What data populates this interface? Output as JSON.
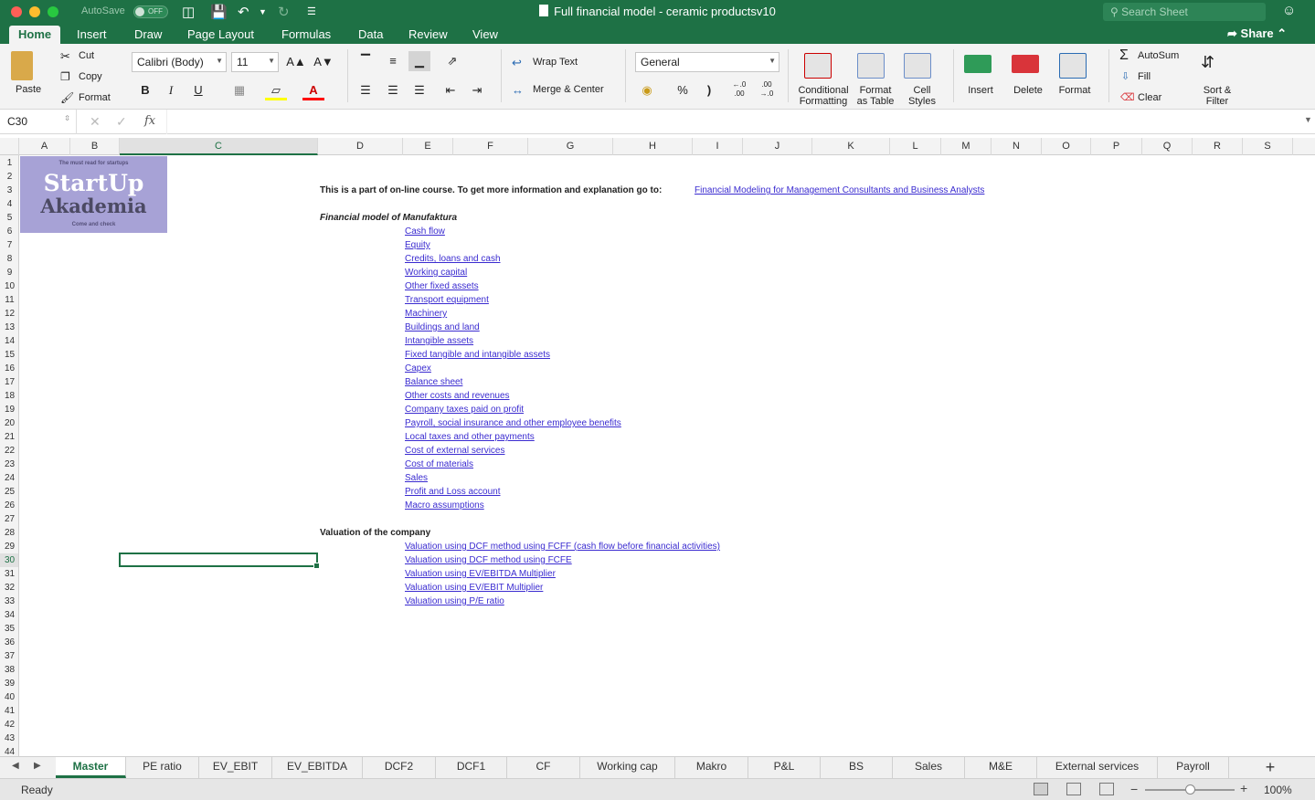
{
  "window": {
    "autosave_label": "AutoSave",
    "autosave_state": "OFF",
    "title": "Full financial model - ceramic productsv10",
    "search_placeholder": "Search Sheet"
  },
  "ribbon_tabs": [
    "Home",
    "Insert",
    "Draw",
    "Page Layout",
    "Formulas",
    "Data",
    "Review",
    "View"
  ],
  "active_ribbon_tab": "Home",
  "share_label": "Share",
  "ribbon": {
    "paste": "Paste",
    "cut": "Cut",
    "copy": "Copy",
    "format_painter": "Format",
    "font_name": "Calibri (Body)",
    "font_size": "11",
    "bold": "B",
    "italic": "I",
    "underline": "U",
    "wrap_text": "Wrap Text",
    "merge_center": "Merge & Center",
    "number_format": "General",
    "percent": "%",
    "comma": ")",
    "conditional_formatting": "Conditional\nFormatting",
    "format_as_table": "Format\nas Table",
    "cell_styles": "Cell\nStyles",
    "insert": "Insert",
    "delete": "Delete",
    "format": "Format",
    "autosum": "AutoSum",
    "fill": "Fill",
    "clear": "Clear",
    "sort_filter": "Sort &\nFilter"
  },
  "formula_bar": {
    "name_box": "C30",
    "fx": "fx",
    "formula": ""
  },
  "columns": [
    "A",
    "B",
    "C",
    "D",
    "E",
    "F",
    "G",
    "H",
    "I",
    "J",
    "K",
    "L",
    "M",
    "N",
    "O",
    "P",
    "Q",
    "R",
    "S"
  ],
  "selected_column": "C",
  "rows": [
    "1",
    "2",
    "3",
    "4",
    "5",
    "6",
    "7",
    "8",
    "9",
    "10",
    "11",
    "12",
    "13",
    "14",
    "15",
    "16",
    "17",
    "18",
    "19",
    "20",
    "21",
    "22",
    "23",
    "24",
    "25",
    "26",
    "27",
    "28",
    "29",
    "30",
    "31",
    "32",
    "33",
    "34",
    "35",
    "36",
    "37",
    "38",
    "39",
    "40",
    "41",
    "42",
    "43",
    "44"
  ],
  "selected_row": "30",
  "logo": {
    "tagline": "The must read for startups",
    "line1": "StartUp",
    "line2": "Akademia",
    "footer": "Come and check"
  },
  "content": {
    "intro": "This is a part of on-line course. To get more information and explanation go to:",
    "course_link": "Financial Modeling for Management Consultants and Business Analysts",
    "model_heading": "Financial model of Manufaktura",
    "model_links": [
      "Cash flow",
      "Equity",
      "Credits, loans and cash",
      "Working capital",
      "Other fixed assets",
      "Transport equipment",
      "Machinery",
      "Buildings and land",
      "Intangible assets",
      "Fixed tangible and intangible assets",
      "Capex",
      "Balance sheet",
      "Other costs and revenues",
      "Company taxes paid on profit",
      "Payroll, social insurance and other employee benefits",
      "Local taxes and other payments",
      "Cost of external services",
      "Cost of materials",
      "Sales",
      "Profit and Loss account",
      "Macro assumptions"
    ],
    "valuation_heading": "Valuation of the company",
    "valuation_links": [
      "Valuation using DCF method using FCFF (cash flow before financial activities)",
      "Valuation using DCF method using FCFE",
      "Valuation using EV/EBITDA Multiplier",
      "Valuation using EV/EBIT Multiplier",
      "Valuation using P/E ratio"
    ]
  },
  "sheet_tabs": [
    "Master",
    "PE ratio",
    "EV_EBIT",
    "EV_EBITDA",
    "DCF2",
    "DCF1",
    "CF",
    "Working cap",
    "Makro",
    "P&L",
    "BS",
    "Sales",
    "M&E",
    "External services",
    "Payroll"
  ],
  "active_sheet": "Master",
  "status": {
    "ready": "Ready",
    "zoom": "100%",
    "zoom_level_percent": 100
  },
  "colors": {
    "accent": "#1e7145",
    "link": "#3a2bd0",
    "logo_bg": "#a7a2d6"
  }
}
